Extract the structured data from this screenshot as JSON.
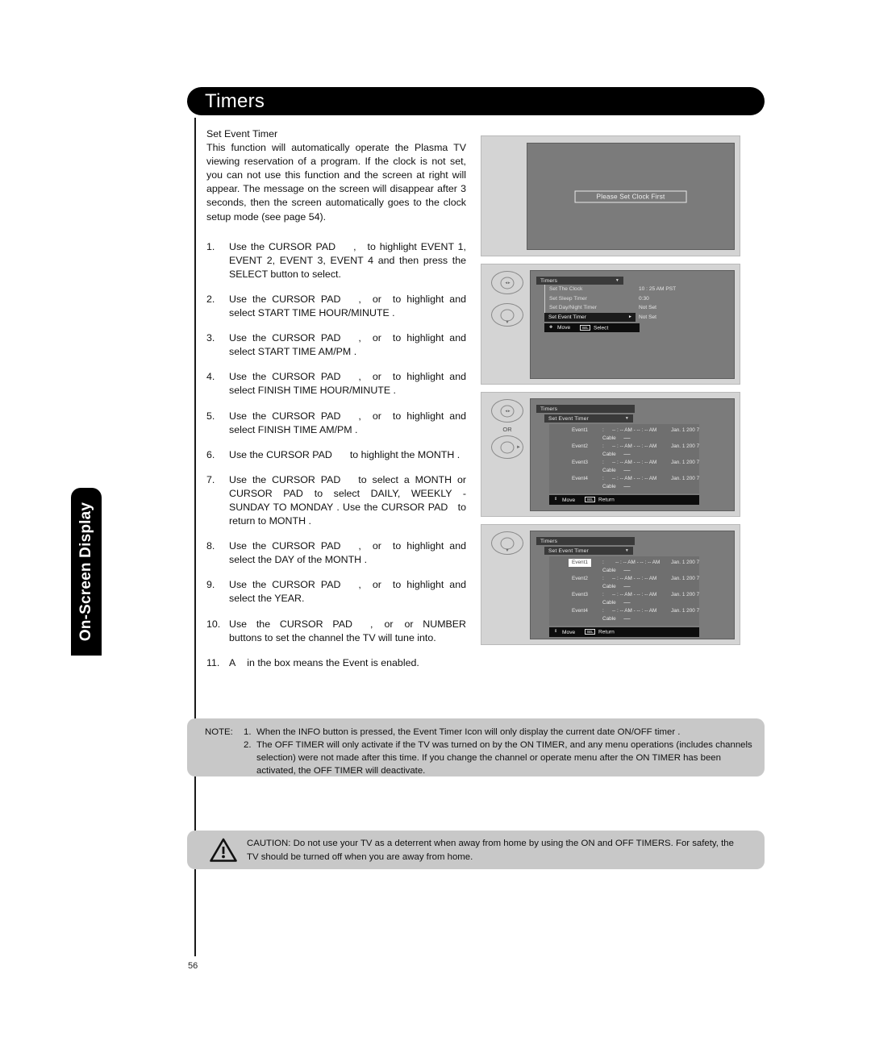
{
  "side_tab": {
    "label": "On-Screen Display"
  },
  "header": {
    "title": "Timers"
  },
  "page_number": "56",
  "left_column": {
    "section_heading": "Set Event Timer",
    "intro": "This function will automatically operate the Plasma TV viewing reservation of a program. If the clock is not set, you can not use this function and the screen  at right will appear. The message on the screen will disappear after 3 seconds, then the screen automatically goes to the clock setup mode (see page 54).",
    "steps": [
      {
        "num": "1.",
        "part_a": "Use the CURSOR PAD",
        "part_b": ",",
        "part_c": "to highlight  EVENT 1, EVENT 2, EVENT 3, EVENT 4 and then press the SELECT button to select."
      },
      {
        "num": "2.",
        "part_a": "Use the CURSOR PAD",
        "part_b": ",",
        "part_c": "or",
        "part_d": "to highlight and select START TIME HOUR/MINUTE ."
      },
      {
        "num": "3.",
        "part_a": "Use the CURSOR PAD",
        "part_b": ",",
        "part_c": "or",
        "part_d": "to highlight and select START TIME AM/PM ."
      },
      {
        "num": "4.",
        "part_a": "Use the CURSOR PAD",
        "part_b": ",",
        "part_c": "or",
        "part_d": "to highlight and select FINISH TIME HOUR/MINUTE ."
      },
      {
        "num": "5.",
        "part_a": "Use the CURSOR PAD",
        "part_b": ",",
        "part_c": "or",
        "part_d": "to highlight and select FINISH TIME AM/PM ."
      },
      {
        "num": "6.",
        "part_a": "Use the CURSOR PAD",
        "part_c": "to highlight the  MONTH ."
      },
      {
        "num": "7.",
        "part_a": "Use the CURSOR PAD",
        "part_c": "to select a MONTH or",
        "part_e": "CURSOR PAD",
        "part_f": "to select DAILY, WEEKLY - SUNDAY TO MONDAY . Use the CURSOR PAD",
        "part_g": "to return to  MONTH ."
      },
      {
        "num": "8.",
        "part_a": "Use the CURSOR PAD",
        "part_b": ",",
        "part_c": "or",
        "part_d": "to highlight and select the DAY of the MONTH ."
      },
      {
        "num": "9.",
        "part_a": "Use the CURSOR PAD",
        "part_b": ",",
        "part_c": "or",
        "part_d": "to highlight and select the YEAR."
      },
      {
        "num": "10.",
        "part_a": "Use the  CURSOR  PAD",
        "part_b": ",",
        "part_c": "or",
        "part_d": "or NUMBER buttons to set the channel the TV will tune into."
      },
      {
        "num": "11.",
        "part_a": "A",
        "part_c": "in the box means the Event is enabled."
      }
    ]
  },
  "figures": {
    "fig1": {
      "message": "Please Set Clock First"
    },
    "fig2": {
      "osd_title": "Timers",
      "rows": [
        {
          "label": "Set The Clock",
          "value": "10 : 25 AM PST",
          "selected": false
        },
        {
          "label": "Set Sleep Timer",
          "value": "0:30",
          "selected": false
        },
        {
          "label": "Set Day/Night Timer",
          "value": "Not Set",
          "selected": false
        },
        {
          "label": "Set Event Timer",
          "value": "Not Set",
          "selected": true
        }
      ],
      "help_move": "Move",
      "help_key": "SEL",
      "help_action": "Select"
    },
    "fig3": {
      "osd_title": "Timers",
      "osd_sub": "Set Event Timer",
      "events": [
        {
          "name": "Event1",
          "colon": ":",
          "time": "-- : -- AM   -   -- : -- AM",
          "date": "Jan. 1 200 7",
          "source": "Cable",
          "source_value": "-------",
          "highlight": false
        },
        {
          "name": "Event2",
          "colon": ":",
          "time": "-- : -- AM   -   -- : -- AM",
          "date": "Jan. 1 200 7",
          "source": "Cable",
          "source_value": "-------",
          "highlight": false
        },
        {
          "name": "Event3",
          "colon": ":",
          "time": "-- : -- AM   -   -- : -- AM",
          "date": "Jan. 1 200 7",
          "source": "Cable",
          "source_value": "-------",
          "highlight": false
        },
        {
          "name": "Event4",
          "colon": ":",
          "time": "-- : -- AM   -   -- : -- AM",
          "date": "Jan. 1 200 7",
          "source": "Cable",
          "source_value": "-------",
          "highlight": false
        }
      ],
      "help_move": "Move",
      "help_key": "SEL",
      "help_action": "Return",
      "or_label": "OR"
    },
    "fig4": {
      "osd_title": "Timers",
      "osd_sub": "Set Event Timer",
      "events": [
        {
          "name": "Event1",
          "colon": ":",
          "time": "-- : -- AM   -   -- : -- AM",
          "date": "Jan. 1 200 7",
          "source": "Cable",
          "source_value": "-------",
          "highlight": true
        },
        {
          "name": "Event2",
          "colon": ":",
          "time": "-- : -- AM   -   -- : -- AM",
          "date": "Jan. 1 200 7",
          "source": "Cable",
          "source_value": "-------",
          "highlight": false
        },
        {
          "name": "Event3",
          "colon": ":",
          "time": "-- : -- AM   -   -- : -- AM",
          "date": "Jan. 1 200 7",
          "source": "Cable",
          "source_value": "-------",
          "highlight": false
        },
        {
          "name": "Event4",
          "colon": ":",
          "time": "-- : -- AM   -   -- : -- AM",
          "date": "Jan. 1 200 7",
          "source": "Cable",
          "source_value": "-------",
          "highlight": false
        }
      ],
      "help_move": "Move",
      "help_key": "SEL",
      "help_action": "Return"
    }
  },
  "note": {
    "label": "NOTE:",
    "item1_num": "1.",
    "item1_text": "When the INFO button is pressed, the Event Timer Icon will only display the current date     ON/OFF timer .",
    "item2_num": "2.",
    "item2_text": "The OFF TIMER will only activate if the TV was turned on by the ON TIMER, and any menu operations (includes channels selection) were not made after this time. If you change the channel or operate menu after the ON TIMER has been activated, the OFF TIMER will deactivate."
  },
  "caution": {
    "text": "CAUTION:  Do not use your TV as a deterrent when away from home by using the    ON and OFF TIMERS. For safety, the TV should be turned off when you are away from home."
  },
  "colors": {
    "header_bar": "#000000",
    "figure_bg": "#d4d4d4",
    "tv_screen": "#7b7b7b",
    "osd_bar": "#3a3a3a",
    "osd_selected": "#1b1b1b",
    "note_bg": "#c8c8c8"
  }
}
